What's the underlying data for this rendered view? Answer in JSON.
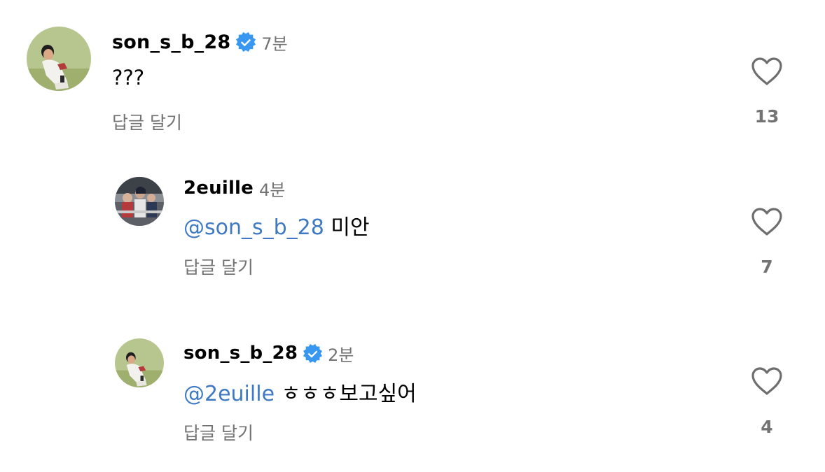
{
  "comments": [
    {
      "username": "son_s_b_28",
      "verified": true,
      "time": "7분",
      "mention": "",
      "text": "???",
      "reply_label": "답글 달기",
      "like_count": "13",
      "avatar": "baseball-player-avatar"
    },
    {
      "username": "2euille",
      "verified": false,
      "time": "4분",
      "mention": "@son_s_b_28",
      "text": " 미안",
      "reply_label": "답글 달기",
      "like_count": "7",
      "avatar": "stadium-crowd-avatar"
    },
    {
      "username": "son_s_b_28",
      "verified": true,
      "time": "2분",
      "mention": "@2euille",
      "text": " ㅎㅎㅎ보고싶어",
      "reply_label": "답글 달기",
      "like_count": "4",
      "avatar": "baseball-player-avatar"
    }
  ],
  "colors": {
    "mention": "#3f79c4",
    "secondary_text": "#737373",
    "verified_badge": "#3897f0",
    "heart_outline": "#6e6e6e"
  }
}
